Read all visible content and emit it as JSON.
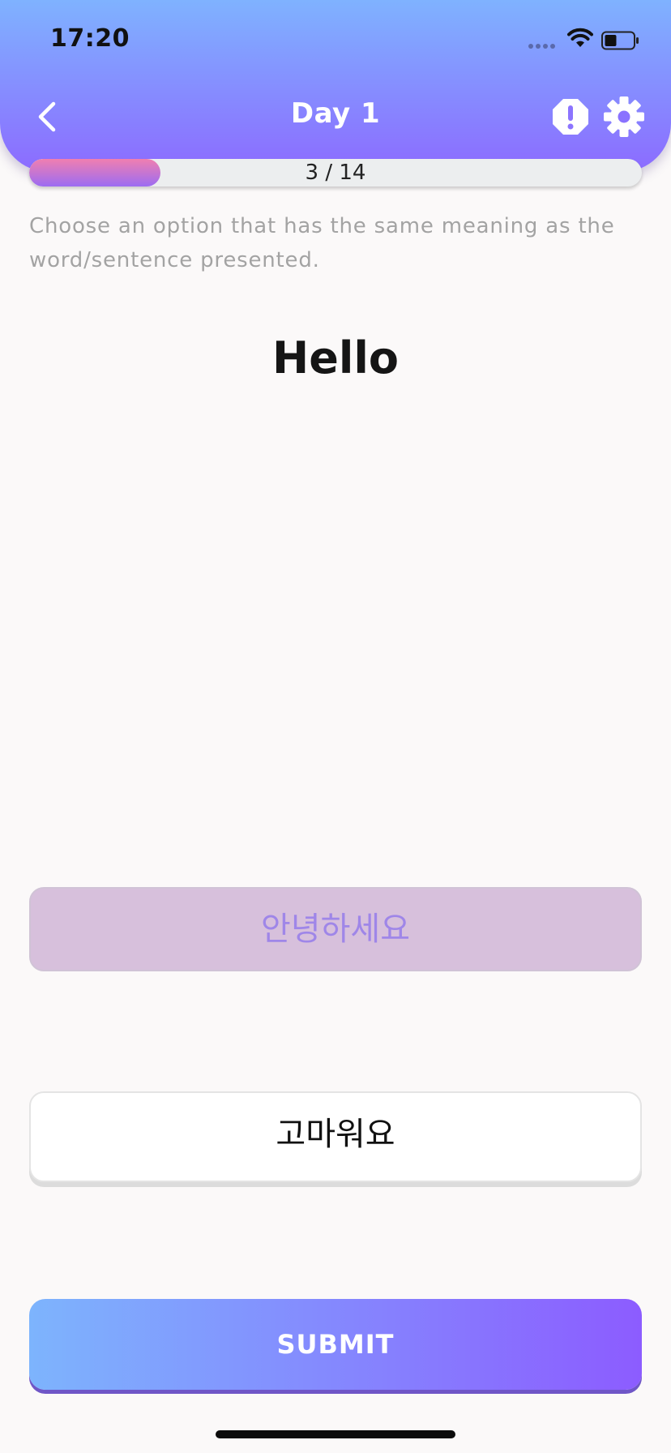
{
  "status_bar": {
    "time": "17:20"
  },
  "header": {
    "title": "Day 1"
  },
  "progress": {
    "current": 3,
    "total": 14,
    "label": "3 / 14"
  },
  "exercise": {
    "instruction": "Choose an option that has the same meaning as the word/sentence presented.",
    "instruction_line1": "Choose an option that has the same meaning as the",
    "instruction_line2": "word/sentence presented.",
    "prompt": "Hello",
    "options": [
      {
        "label": "안녕하세요",
        "state": "selected"
      },
      {
        "label": "고마워요",
        "state": "default"
      }
    ]
  },
  "submit": {
    "label": "SUBMIT"
  },
  "icons": {
    "back": "chevron-left-icon",
    "report": "exclamation-octagon-icon",
    "settings": "gear-icon",
    "wifi": "wifi-icon",
    "battery": "battery-icon"
  },
  "colors": {
    "header_gradient_top": "#7fb2ff",
    "header_gradient_bottom": "#8c6bff",
    "progress_fill_top": "#f07fb0",
    "progress_fill_bottom": "#9c6cf2",
    "selected_option_bg": "#d7c0dc",
    "selected_option_text": "#9f86e8",
    "submit_gradient_start": "#7db4fd",
    "submit_gradient_end": "#8c5cff"
  }
}
